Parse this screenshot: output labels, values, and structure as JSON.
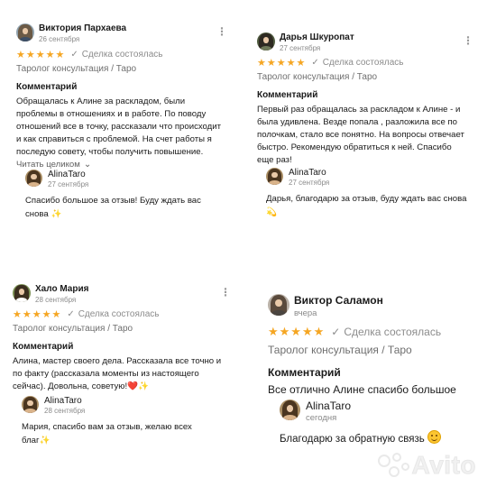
{
  "reviews": [
    {
      "author": "Виктория Пархаева",
      "date": "26 сентября",
      "stars": "★★★★★",
      "deal_status": "Сделка состоялась",
      "category": "Таролог консультация / Таро",
      "comment_title": "Комментарий",
      "comment": "Обращалась к Алине за раскладом, были\nпроблемы в отношениях и в работе. По поводу\nотношений все в точку, рассказали что происходит\nи как справиться с проблемой. На счет работы я\nпоследую совету,  чтобы получить повышение.",
      "show_more": "Читать целиком",
      "reply": {
        "author": "AlinaTaro",
        "date": "27 сентября",
        "text": "Спасибо большое за отзыв! Буду ждать вас\nснова",
        "emoji": "✨"
      }
    },
    {
      "author": "Дарья Шкуропат",
      "date": "27 сентября",
      "stars": "★★★★★",
      "deal_status": "Сделка состоялась",
      "category": "Таролог консультация / Таро",
      "comment_title": "Комментарий",
      "comment": "Первый раз обращалась за раскладом к Алине - и\nбыла удивлена. Везде попала , разложила все по\nполочкам, стало все понятно. На вопросы отвечает\nбыстро. Рекомендую обратиться к ней. Спасибо\nеще раз!",
      "reply": {
        "author": "AlinaTaro",
        "date": "27 сентября",
        "text": "Дарья, благодарю за отзыв, буду ждать вас снова",
        "emoji": "💫"
      }
    },
    {
      "author": "Хало Мария",
      "date": "28 сентября",
      "stars": "★★★★★",
      "deal_status": "Сделка состоялась",
      "category": "Таролог консультация / Таро",
      "comment_title": "Комментарий",
      "comment": "Алина, мастер своего дела. Рассказала все точно и\nпо факту (рассказала моменты из настоящего\nсейчас). Довольна, советую!",
      "comment_emoji": "❤️✨",
      "reply": {
        "author": "AlinaTaro",
        "date": "28 сентября",
        "text": "Мария, спасибо вам за отзыв, желаю всех\nблаг",
        "emoji": "✨"
      }
    },
    {
      "author": "Виктор Саламон",
      "date": "вчера",
      "stars": "★★★★★",
      "deal_status": "Сделка состоялась",
      "category": "Таролог консультация / Таро",
      "comment_title": "Комментарий",
      "comment": "Все отлично Алине спасибо большое",
      "reply": {
        "author": "AlinaTaro",
        "date": "сегодня",
        "text": "Благодарю за обратную связь",
        "emoji": "☺️"
      }
    }
  ],
  "kebab_glyph": "⋮",
  "check_glyph": "✓",
  "chevron_glyph": "⌄",
  "watermark": "Avito",
  "colors": {
    "star": "#f5a623",
    "muted": "#8a8a8a"
  },
  "icons": [
    "kebab-menu-icon",
    "check-icon",
    "star-icon",
    "chevron-down-icon",
    "avito-logo-icon"
  ]
}
